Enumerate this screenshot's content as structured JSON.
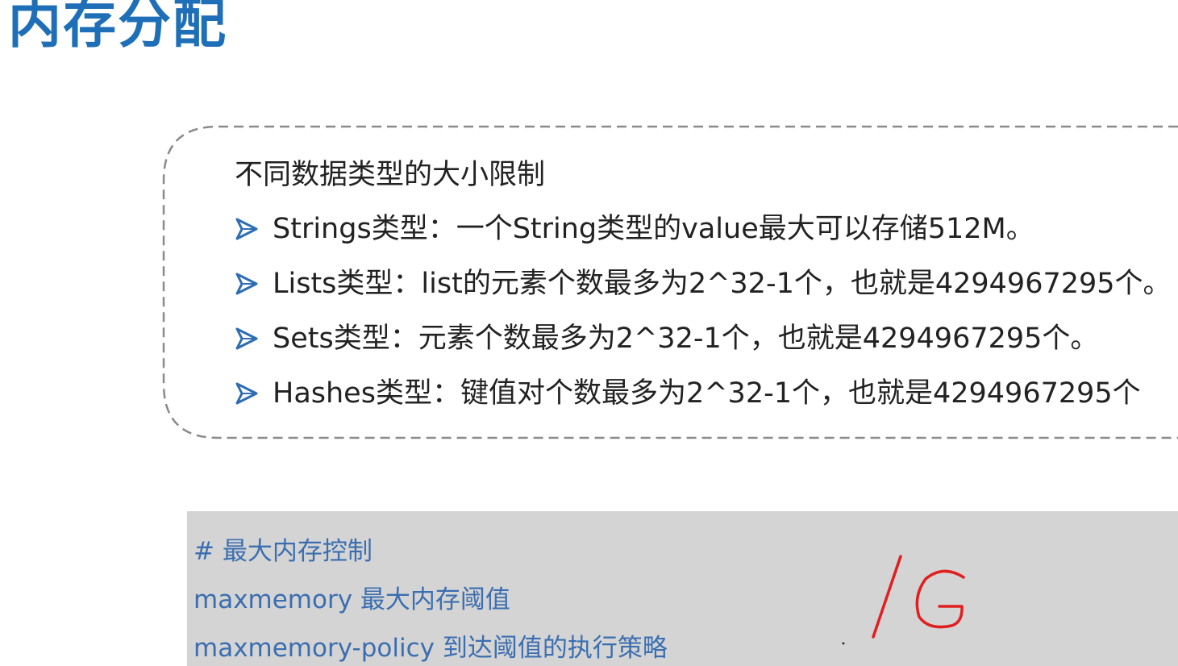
{
  "page": {
    "title": "内存分配"
  },
  "limits_box": {
    "heading": "不同数据类型的大小限制",
    "items": [
      {
        "icon": "arrow-right-icon",
        "text": "Strings类型：一个String类型的value最大可以存储512M。"
      },
      {
        "icon": "arrow-right-icon",
        "text": "Lists类型：list的元素个数最多为2^32-1个，也就是4294967295个。"
      },
      {
        "icon": "arrow-right-icon",
        "text": "Sets类型：元素个数最多为2^32-1个，也就是4294967295个。"
      },
      {
        "icon": "arrow-right-icon",
        "text": "Hashes类型：键值对个数最多为2^32-1个，也就是4294967295个"
      }
    ]
  },
  "config_block": {
    "lines": [
      "# 最大内存控制",
      "maxmemory 最大内存阈值",
      "maxmemory-policy 到达阈值的执行策略"
    ]
  },
  "handwritten_annotation": {
    "text": "1G",
    "color": "#e02020"
  },
  "colors": {
    "title": "#1e6fb8",
    "bullet_arrow": "#2e6db4",
    "code_text": "#3b6eb0",
    "code_background": "#d4d4d4",
    "dashed_border": "#8a8a8a"
  }
}
